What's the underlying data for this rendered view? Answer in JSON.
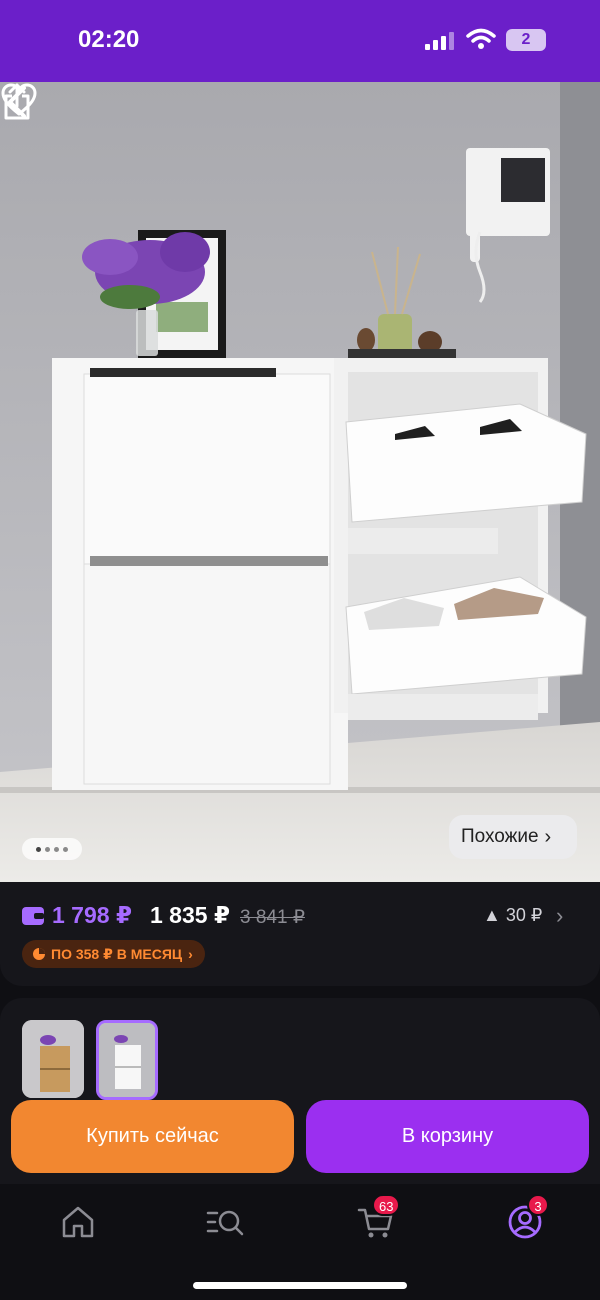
{
  "status_bar": {
    "time": "02:20",
    "battery": "2",
    "bg_color": "#6b1fc9"
  },
  "hero": {
    "image_subject": "white wall-mounted shoe cabinet",
    "pagination_total": 4,
    "pagination_active": 0,
    "similar_label": "Похожие",
    "icons": [
      "back-icon",
      "heart-icon",
      "share-icon"
    ]
  },
  "price": {
    "wallet_price": "1 798 ₽",
    "price": "1 835 ₽",
    "old_price": "3 841 ₽",
    "diff": "▲ 30 ₽",
    "installment": "ПО 358 ₽ В МЕСЯЦ",
    "wallet_color": "#a66bff"
  },
  "variants": {
    "selected_index": 1,
    "count": 2
  },
  "actions": {
    "buy_now": "Купить сейчас",
    "add_to_cart": "В корзину",
    "buy_color": "#f28730",
    "cart_color": "#9b2ff0"
  },
  "nav": {
    "items": [
      "home-icon",
      "catalog-search-icon",
      "cart-icon",
      "profile-icon"
    ],
    "cart_badge": "63",
    "profile_badge": "3"
  }
}
